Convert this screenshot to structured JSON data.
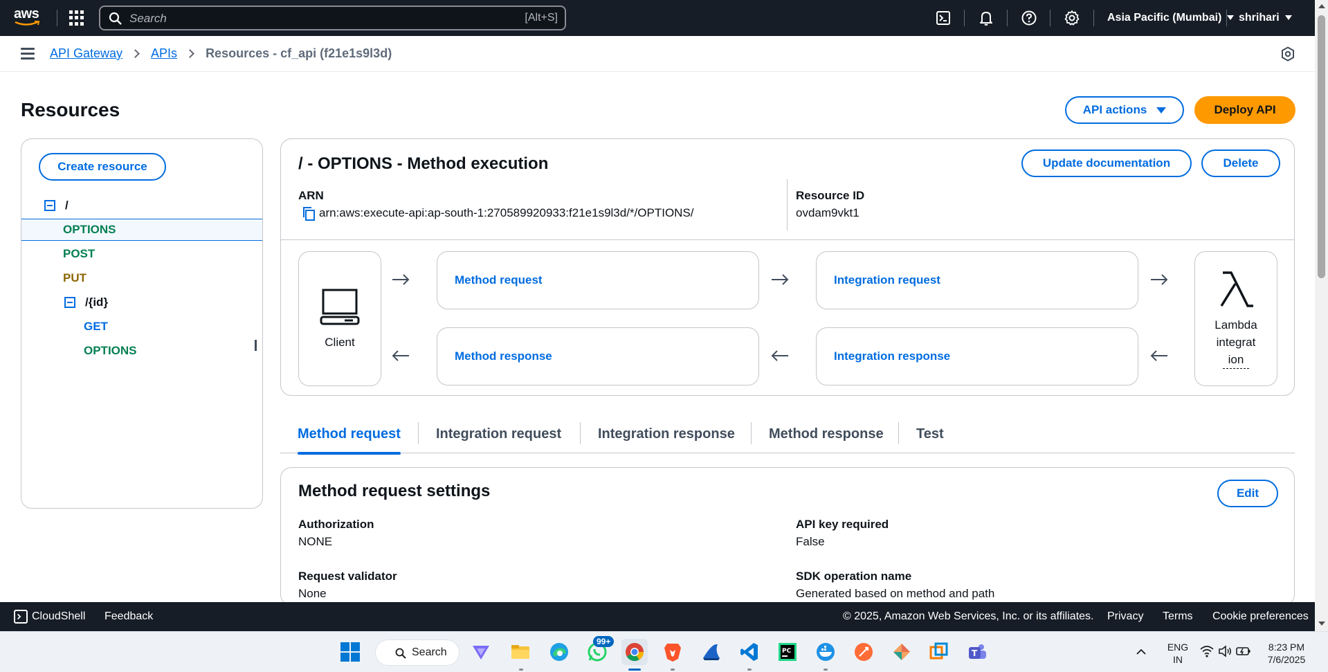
{
  "topnav": {
    "logo_text": "aws",
    "search_placeholder": "Search",
    "search_shortcut": "[Alt+S]",
    "icons": [
      "cloudshell-icon",
      "bell-icon",
      "help-icon",
      "gear-icon"
    ],
    "region": "Asia Pacific (Mumbai)",
    "user": "shrihari"
  },
  "breadcrumb": {
    "items": [
      "API Gateway",
      "APIs"
    ],
    "current": "Resources - cf_api (f21e1s9l3d)"
  },
  "page": {
    "title": "Resources",
    "api_actions_label": "API actions",
    "deploy_label": "Deploy API"
  },
  "tree": {
    "create_label": "Create resource",
    "root": "/",
    "root_methods": [
      "OPTIONS",
      "POST",
      "PUT"
    ],
    "child": "/{id}",
    "child_methods": [
      "GET",
      "OPTIONS"
    ]
  },
  "execution": {
    "title": "/ - OPTIONS - Method execution",
    "update_doc_label": "Update documentation",
    "delete_label": "Delete",
    "arn_label": "ARN",
    "arn_value": "arn:aws:execute-api:ap-south-1:270589920933:f21e1s9l3d/*/OPTIONS/",
    "resource_id_label": "Resource ID",
    "resource_id_value": "ovdam9vkt1",
    "client_label": "Client",
    "method_request": "Method request",
    "integration_request": "Integration request",
    "method_response": "Method response",
    "integration_response": "Integration response",
    "lambda_label": "Lambda integration",
    "lambda_lines": [
      "Lambda",
      "integrat",
      "ion"
    ]
  },
  "tabs": [
    "Method request",
    "Integration request",
    "Integration response",
    "Method response",
    "Test"
  ],
  "settings": {
    "title": "Method request settings",
    "edit_label": "Edit",
    "authorization_label": "Authorization",
    "authorization_value": "NONE",
    "api_key_label": "API key required",
    "api_key_value": "False",
    "validator_label": "Request validator",
    "validator_value": "None",
    "sdk_label": "SDK operation name",
    "sdk_value": "Generated based on method and path"
  },
  "footer": {
    "cloudshell": "CloudShell",
    "feedback": "Feedback",
    "copyright": "© 2025, Amazon Web Services, Inc. or its affiliates.",
    "privacy": "Privacy",
    "terms": "Terms",
    "cookies": "Cookie preferences"
  },
  "taskbar": {
    "search_label": "Search",
    "badge": "99+",
    "lang_top": "ENG",
    "lang_bottom": "IN",
    "time": "8:23 PM",
    "date": "7/6/2025"
  },
  "colors": {
    "nav_bg": "#161d26",
    "link": "#006ce0",
    "primary": "#ff9900",
    "options_method": "#037f51",
    "put_method": "#8d6605"
  }
}
